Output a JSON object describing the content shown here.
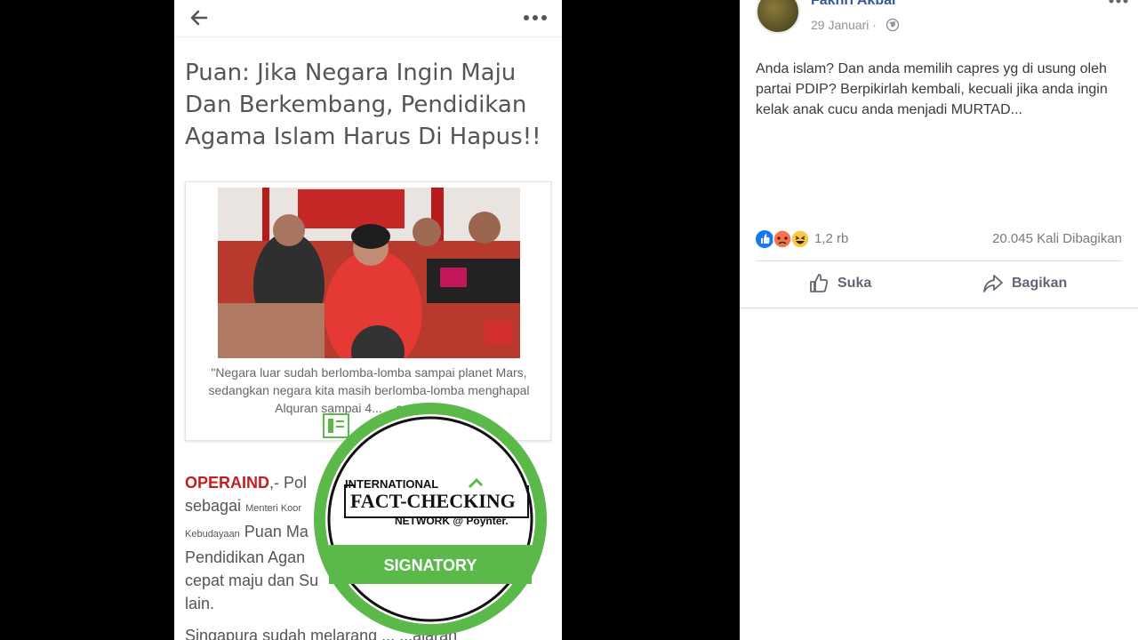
{
  "article": {
    "headline": "Puan: Jika Negara Ingin Maju Dan Berkembang, Pendidikan Agama Islam Harus Di Hapus!!",
    "caption": "\"Negara luar sudah berlomba-lomba sampai planet Mars, sedangkan negara kita masih berlomba-lomba menghapal Alquran sampai 4... ...a wartawan,",
    "source": "OPERAIND",
    "body_seg1": ",- Pol",
    "body_seg2": "sebagai",
    "body_small1": "Menteri Koor",
    "body_small2": "Kebudayaan",
    "body_seg3": "Puan Ma",
    "body_seg4": "Pendidikan Agan",
    "body_seg5": "cepat maju dan Su",
    "body_seg6": "lain.",
    "body_cont": "Singapura sudah melarang ... ...ajaran"
  },
  "badge": {
    "line1": "INTERNATIONAL",
    "line2": "FACT-CHECKING",
    "line3": "NETWORK @ Poynter.",
    "ribbon": "SIGNATORY"
  },
  "fb": {
    "author": "Fakhri Akbar",
    "date": "29 Januari ·",
    "post_text": "Anda islam? Dan anda memilih capres yg di usung oleh partai PDIP? Berpikirlah kembali, kecuali jika anda ingin kelak anak cucu anda menjadi MURTAD...",
    "reaction_count": "1,2 rb",
    "shares": "20.045 Kali Dibagikan",
    "like_label": "Suka",
    "share_label": "Bagikan"
  },
  "colors": {
    "fb_blue": "#385898",
    "badge_green": "#5bb94a",
    "source_red": "#c41e1e"
  },
  "icons": [
    "back-arrow-icon",
    "more-dots-icon",
    "globe-icon",
    "like-icon",
    "love-icon",
    "angry-icon",
    "haha-icon",
    "thumbs-up-icon",
    "share-arrow-icon",
    "document-icon"
  ]
}
